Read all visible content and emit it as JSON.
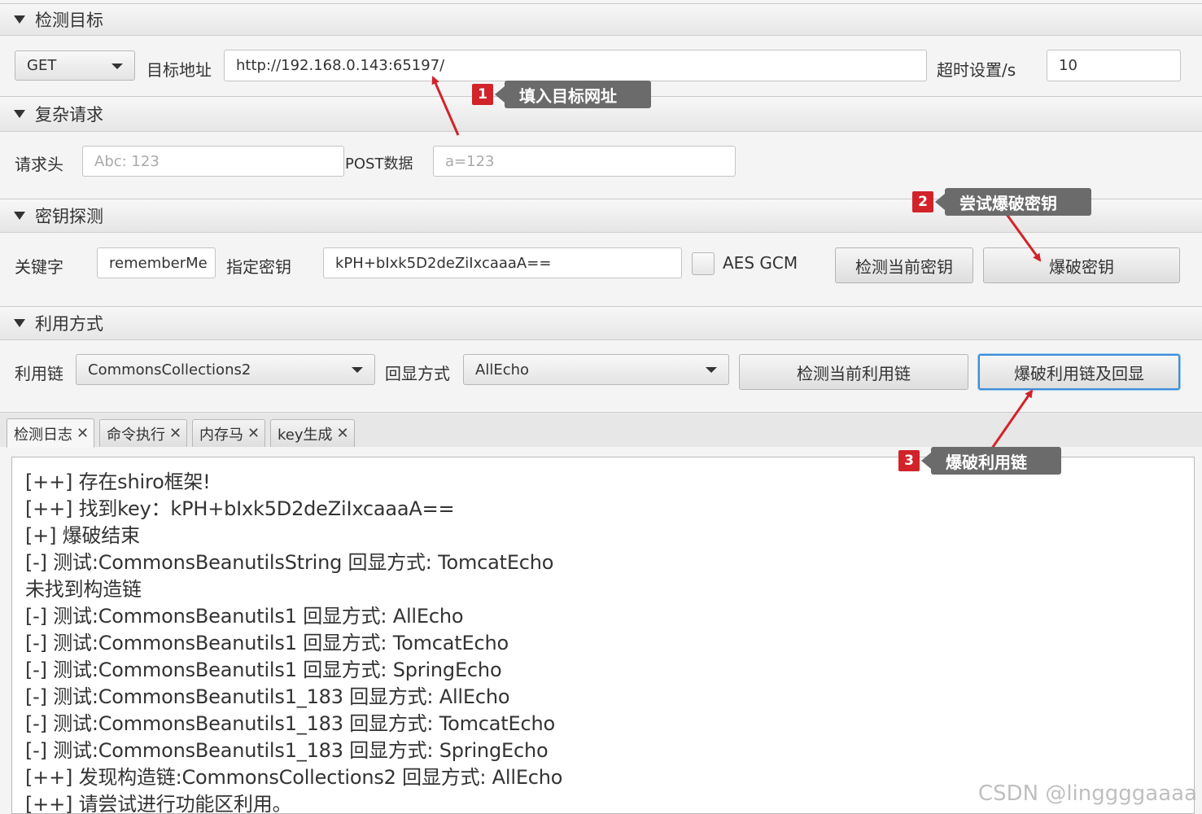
{
  "sections": {
    "target": "检测目标",
    "complex": "复杂请求",
    "key": "密钥探测",
    "exploit": "利用方式"
  },
  "target": {
    "method": "GET",
    "url_label": "目标地址",
    "url_value": "http://192.168.0.143:65197/",
    "timeout_label": "超时设置/s",
    "timeout_value": "10"
  },
  "complex": {
    "header_label": "请求头",
    "header_placeholder": "Abc: 123",
    "post_label": "POST数据",
    "post_placeholder": "a=123"
  },
  "key": {
    "keyword_label": "关键字",
    "keyword_value": "rememberMe",
    "key_label": "指定密钥",
    "key_value": "kPH+bIxk5D2deZiIxcaaaA==",
    "gcm_label": "AES GCM",
    "gcm_checked": false,
    "check_button": "检测当前密钥",
    "brute_button": "爆破密钥"
  },
  "exploit": {
    "chain_label": "利用链",
    "chain_value": "CommonsCollections2",
    "echo_label": "回显方式",
    "echo_value": "AllEcho",
    "check_button": "检测当前利用链",
    "brute_button": "爆破利用链及回显"
  },
  "tabs": [
    {
      "label": "检测日志",
      "active": true
    },
    {
      "label": "命令执行",
      "active": false
    },
    {
      "label": "内存马",
      "active": false
    },
    {
      "label": "key生成",
      "active": false
    }
  ],
  "tab_close": "✕",
  "log": [
    "[++] 存在shiro框架!",
    "[++] 找到key：kPH+bIxk5D2deZiIxcaaaA==",
    "[+] 爆破结束",
    "[-] 测试:CommonsBeanutilsString  回显方式: TomcatEcho",
    "未找到构造链",
    "[-] 测试:CommonsBeanutils1  回显方式: AllEcho",
    "[-] 测试:CommonsBeanutils1  回显方式: TomcatEcho",
    "[-] 测试:CommonsBeanutils1  回显方式: SpringEcho",
    "[-] 测试:CommonsBeanutils1_183  回显方式: AllEcho",
    "[-] 测试:CommonsBeanutils1_183  回显方式: TomcatEcho",
    "[-] 测试:CommonsBeanutils1_183  回显方式: SpringEcho",
    "[++] 发现构造链:CommonsCollections2  回显方式: AllEcho",
    "[++] 请尝试进行功能区利用。"
  ],
  "callouts": [
    {
      "num": "1",
      "text": "填入目标网址"
    },
    {
      "num": "2",
      "text": "尝试爆破密钥"
    },
    {
      "num": "3",
      "text": "爆破利用链"
    }
  ],
  "watermark": "CSDN @linggggaaaa",
  "colors": {
    "callout_red": "#d2232a",
    "callout_gray": "#6b6b6b",
    "focus_blue": "#3d8fd6"
  }
}
